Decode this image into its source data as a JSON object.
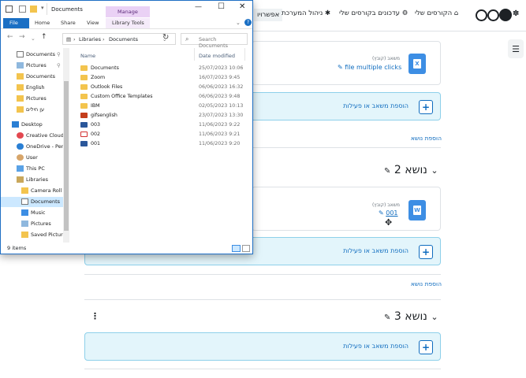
{
  "moodle": {
    "nav": {
      "my_courses": "הקורסים שלי",
      "course_updates": "עדכונים בקורסים שלי",
      "site_admin": "ניהול המערכת",
      "options_partial": "אפשרויו"
    },
    "activity1": {
      "type": "משאב (קובץ)",
      "name": "file multiple clicks",
      "icon_letter": "X"
    },
    "add_activity_label": "הוספת משאב או פעילות",
    "add_topic_label": "הוספת נושא",
    "section2": {
      "title": "נושא 2"
    },
    "activity2": {
      "type": "משאב (קובץ)",
      "name": "001",
      "icon_letter": "W"
    },
    "section3": {
      "title": "נושא 3"
    }
  },
  "explorer": {
    "title": "Documents",
    "ribbon": {
      "manage": "Manage",
      "file": "File",
      "home": "Home",
      "share": "Share",
      "view": "View",
      "library_tools": "Library Tools"
    },
    "address": {
      "libraries": "Libraries",
      "documents": "Documents"
    },
    "search_placeholder": "Search Documents",
    "nav_items": [
      {
        "label": "Documents",
        "icon": "documents-icon",
        "pinned": true
      },
      {
        "label": "Pictures",
        "icon": "pictures-icon",
        "pinned": true
      },
      {
        "label": "Documents",
        "icon": "folder-icon"
      },
      {
        "label": "English",
        "icon": "folder-icon"
      },
      {
        "label": "Pictures",
        "icon": "folder-icon"
      },
      {
        "label": "ען חילים",
        "icon": "folder-icon"
      },
      {
        "label": "Desktop",
        "icon": "desktop-icon"
      },
      {
        "label": "Creative Cloud",
        "icon": "creative-cloud-icon"
      },
      {
        "label": "OneDrive - Pers",
        "icon": "onedrive-icon"
      },
      {
        "label": "User",
        "icon": "user-icon"
      },
      {
        "label": "This PC",
        "icon": "pc-icon"
      },
      {
        "label": "Libraries",
        "icon": "libraries-icon"
      },
      {
        "label": "Camera Roll",
        "icon": "folder-icon"
      },
      {
        "label": "Documents",
        "icon": "documents-icon",
        "selected": true
      },
      {
        "label": "Music",
        "icon": "music-icon"
      },
      {
        "label": "Pictures",
        "icon": "pictures-icon"
      },
      {
        "label": "Saved Picture",
        "icon": "folder-icon"
      }
    ],
    "columns": {
      "name": "Name",
      "date": "Date modified"
    },
    "files": [
      {
        "name": "Documents",
        "date": "25/07/2023 10:06",
        "type": "folder"
      },
      {
        "name": "Zoom",
        "date": "16/07/2023 9:45",
        "type": "folder"
      },
      {
        "name": "Outlook Files",
        "date": "06/06/2023 16:32",
        "type": "folder"
      },
      {
        "name": "Custom Office Templates",
        "date": "06/06/2023 9:48",
        "type": "folder"
      },
      {
        "name": "IBM",
        "date": "02/05/2023 10:13",
        "type": "folder"
      },
      {
        "name": "gifsenglish",
        "date": "23/07/2023 13:30",
        "type": "pptx"
      },
      {
        "name": "003",
        "date": "11/06/2023 9:22",
        "type": "docx"
      },
      {
        "name": "002",
        "date": "11/06/2023 9:21",
        "type": "pdf"
      },
      {
        "name": "001",
        "date": "11/06/2023 9:20",
        "type": "docx"
      }
    ],
    "status": "9 items"
  },
  "colors": {
    "folder": "#f3c44e",
    "docx": "#2b579a",
    "pptx": "#c43e1c",
    "pdf": "#d32f2f",
    "accent": "#0f6cbf",
    "band": "#e3f5fb"
  }
}
